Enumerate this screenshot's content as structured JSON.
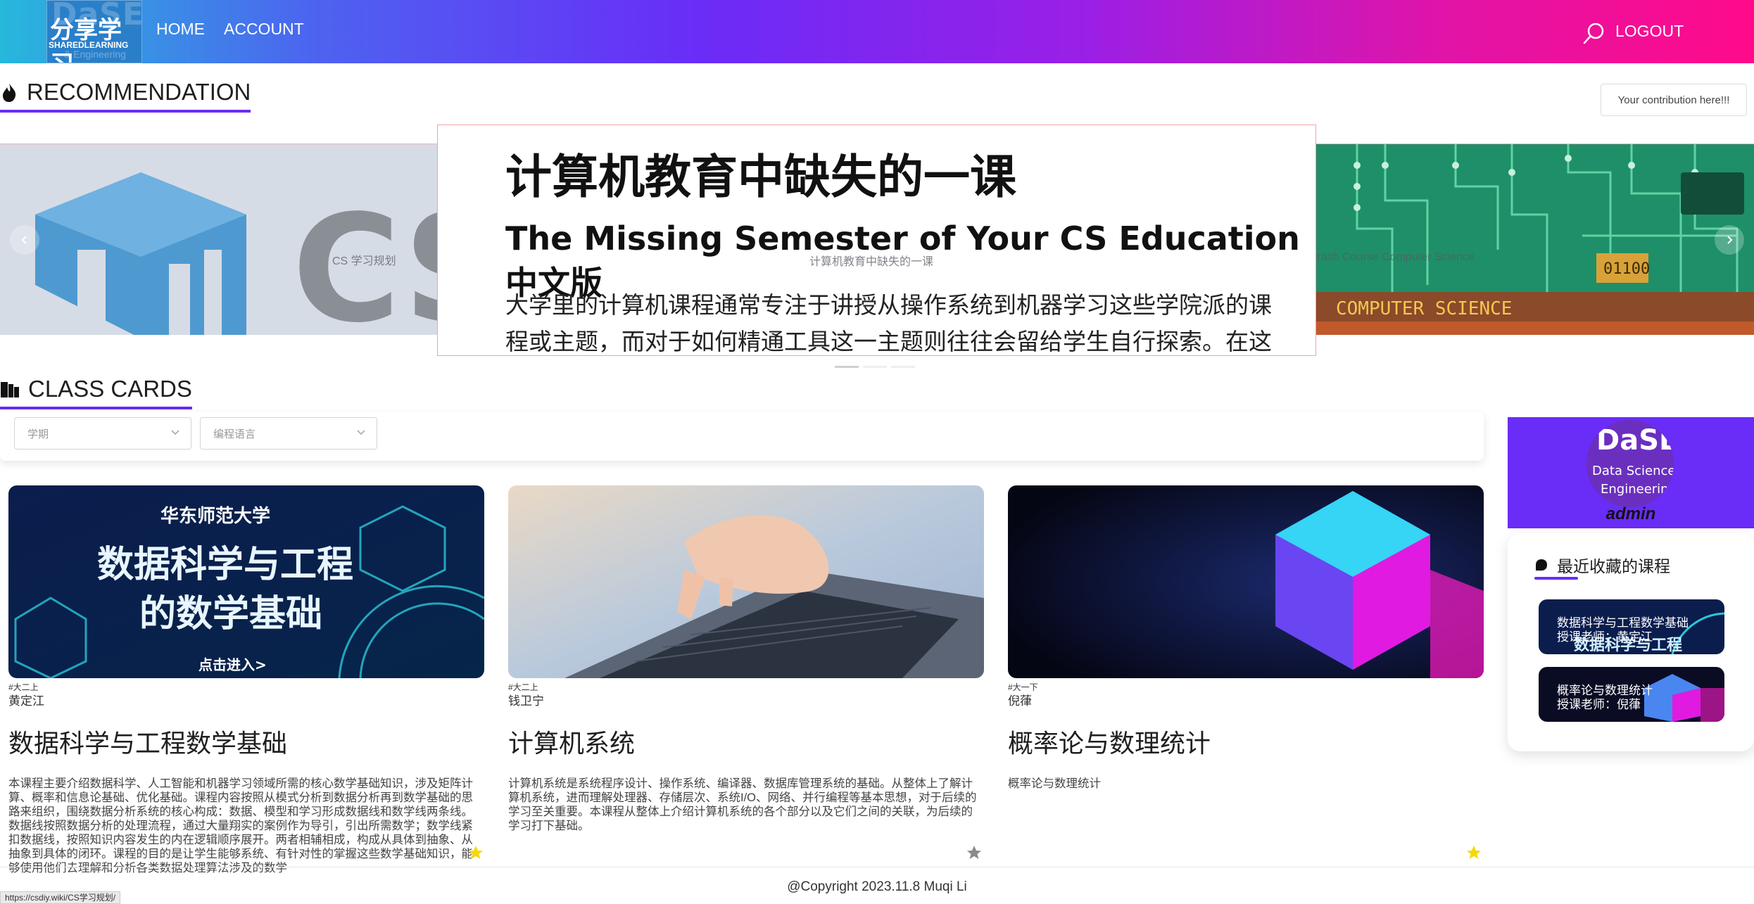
{
  "colors": {
    "accent": "#6a2cf7",
    "header_start": "#27b8dc",
    "header_end": "#ff0a8a",
    "star_active": "#f5d90a",
    "star_inactive": "#8a8a8a"
  },
  "header": {
    "logo": {
      "main": "分享学习",
      "bg_text": "DaSE",
      "sub": "SHAREDLEARNING",
      "sub2": "& Engineering"
    },
    "nav": [
      {
        "label": "HOME"
      },
      {
        "label": "ACCOUNT"
      }
    ],
    "search_icon": "search-icon",
    "logout_label": "LOGOUT"
  },
  "recommendation": {
    "title": "RECOMMENDATION",
    "icon": "fire-icon",
    "contribution_button": "Your contribution here!!!"
  },
  "carousel": {
    "slides": [
      {
        "caption": "CS 学习规划",
        "image_text": "CS"
      },
      {
        "caption": "计算机教育中缺失的一课",
        "title": "计算机教育中缺失的一课",
        "subtitle": "The Missing Semester of Your CS Education 中文版",
        "body": "大学里的计算机课程通常专注于讲授从操作系统到机器学习这些学院派的课程或主题，而对于如何精通工具这一主题则往往会留给学生自行探索。在这"
      },
      {
        "caption": "Crash Course Computer Science",
        "image_text": "COMPUTER SCIENCE",
        "chip_text": "01100"
      }
    ],
    "prev_icon": "chevron-left-icon",
    "next_icon": "chevron-right-icon",
    "active_index": 1
  },
  "class_cards": {
    "title": "CLASS CARDS",
    "icon": "book-icon",
    "filters": [
      {
        "placeholder": "学期"
      },
      {
        "placeholder": "编程语言"
      }
    ],
    "cards": [
      {
        "tag": "#大二上",
        "teacher": "黄定江",
        "title": "数据科学与工程数学基础",
        "desc": "本课程主要介绍数据科学、人工智能和机器学习领域所需的核心数学基础知识，涉及矩阵计算、概率和信息论基础、优化基础。课程内容按照从模式分析到数据分析再到数学基础的思路来组织，围绕数据分析系统的核心构成：数据、模型和学习形成数据线和数学线两条线。数据线按照数据分析的处理流程，通过大量翔实的案例作为导引，引出所需数学；数学线紧扣数据线，按照知识内容发生的内在逻辑顺序展开。两者相辅相成，构成从具体到抽象、从抽象到具体的闭环。课程的目的是让学生能够系统、有针对性的掌握这些数学基础知识，能够使用他们去理解和分析各类数据处理算法涉及的数学",
        "img_title": "数据科学与工程\n的数学基础",
        "img_school": "华东师范大学",
        "img_cta": "点击进入>",
        "starred": true
      },
      {
        "tag": "#大二上",
        "teacher": "钱卫宁",
        "title": "计算机系统",
        "desc": "计算机系统是系统程序设计、操作系统、编译器、数据库管理系统的基础。从整体上了解计算机系统，进而理解处理器、存储层次、系统I/O、网络、并行编程等基本思想，对于后续的学习至关重要。本课程从整体上介绍计算机系统的各个部分以及它们之间的关联，为后续的学习打下基础。",
        "starred": false
      },
      {
        "tag": "#大一下",
        "teacher": "倪葎",
        "title": "概率论与数理统计",
        "desc": "概率论与数理统计",
        "starred": true
      }
    ]
  },
  "sidebar": {
    "avatar": {
      "line1": "DaSE",
      "line2": "Data Science",
      "line3": "Engineering"
    },
    "username": "admin",
    "favorites_title": "最近收藏的课程",
    "favorites_icon": "bookmark-icon",
    "favorites": [
      {
        "line1": "数据科学与工程数学基础",
        "line2": "授课老师：黄定江",
        "overlay": "数据科学与工程"
      },
      {
        "line1": "概率论与数理统计",
        "line2": "授课老师：倪葎"
      }
    ]
  },
  "footer": {
    "copyright": "@Copyright 2023.11.8 Muqi Li",
    "status_url": "https://csdiy.wiki/CS学习规划/"
  }
}
